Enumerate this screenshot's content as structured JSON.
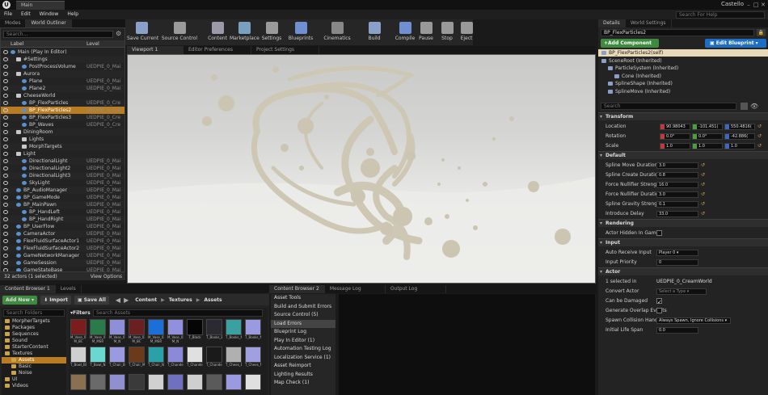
{
  "window": {
    "tab": "Main",
    "project": "Castello",
    "help_placeholder": "Search For Help"
  },
  "menu": [
    "File",
    "Edit",
    "Window",
    "Help"
  ],
  "left_tabs": [
    "Modes",
    "World Outliner"
  ],
  "outliner": {
    "search_placeholder": "Search...",
    "col_label": "Label",
    "col_type": "Level",
    "rows": [
      {
        "label": "Main (Play In Editor)",
        "type": "",
        "indent": 0,
        "icon": "actor"
      },
      {
        "label": "#Settings",
        "type": "",
        "indent": 1,
        "icon": "folder"
      },
      {
        "label": "PostProcessVolume",
        "type": "UEDPIE_0_Mai",
        "indent": 2,
        "icon": "actor"
      },
      {
        "label": "Aurora",
        "type": "",
        "indent": 1,
        "icon": "folder"
      },
      {
        "label": "Plane",
        "type": "UEDPIE_0_Mai",
        "indent": 2,
        "icon": "actor"
      },
      {
        "label": "Plane2",
        "type": "UEDPIE_0_Mai",
        "indent": 2,
        "icon": "actor"
      },
      {
        "label": "CheeseWorld",
        "type": "",
        "indent": 1,
        "icon": "folder"
      },
      {
        "label": "BP_FlexParticles",
        "type": "UEDPIE_0_Cre",
        "indent": 2,
        "icon": "actor"
      },
      {
        "label": "BP_FlexParticles2",
        "type": "UEDPIE_0_Cre",
        "indent": 2,
        "icon": "actor",
        "sel": true
      },
      {
        "label": "BP_FlexParticles3",
        "type": "UEDPIE_0_Cre",
        "indent": 2,
        "icon": "actor"
      },
      {
        "label": "BP_Waves",
        "type": "UEDPIE_0_Cre",
        "indent": 2,
        "icon": "actor"
      },
      {
        "label": "DiningRoom",
        "type": "",
        "indent": 1,
        "icon": "folder"
      },
      {
        "label": "Lights",
        "type": "",
        "indent": 2,
        "icon": "folder"
      },
      {
        "label": "MorphTargets",
        "type": "",
        "indent": 2,
        "icon": "folder"
      },
      {
        "label": "Light",
        "type": "",
        "indent": 1,
        "icon": "folder"
      },
      {
        "label": "DirectionalLight",
        "type": "UEDPIE_0_Mai",
        "indent": 2,
        "icon": "actor"
      },
      {
        "label": "DirectionalLight2",
        "type": "UEDPIE_0_Mai",
        "indent": 2,
        "icon": "actor"
      },
      {
        "label": "DirectionalLight3",
        "type": "UEDPIE_0_Mai",
        "indent": 2,
        "icon": "actor"
      },
      {
        "label": "SkyLight",
        "type": "UEDPIE_0_Mai",
        "indent": 2,
        "icon": "actor"
      },
      {
        "label": "BP_AudioManager",
        "type": "UEDPIE_0_Mai",
        "indent": 1,
        "icon": "actor"
      },
      {
        "label": "BP_GameMode",
        "type": "UEDPIE_0_Mai",
        "indent": 1,
        "icon": "actor"
      },
      {
        "label": "BP_MainPawn",
        "type": "UEDPIE_0_Mai",
        "indent": 1,
        "icon": "actor"
      },
      {
        "label": "BP_HandLeft",
        "type": "UEDPIE_0_Mai",
        "indent": 2,
        "icon": "actor"
      },
      {
        "label": "BP_HandRight",
        "type": "UEDPIE_0_Mai",
        "indent": 2,
        "icon": "actor"
      },
      {
        "label": "BP_UserFlow",
        "type": "UEDPIE_0_Mai",
        "indent": 1,
        "icon": "actor"
      },
      {
        "label": "CameraActor",
        "type": "UEDPIE_0_Mai",
        "indent": 1,
        "icon": "actor"
      },
      {
        "label": "FlexFluidSurfaceActor1",
        "type": "UEDPIE_0_Mai",
        "indent": 1,
        "icon": "actor"
      },
      {
        "label": "FlexFluidSurfaceActor2",
        "type": "UEDPIE_0_Mai",
        "indent": 1,
        "icon": "actor"
      },
      {
        "label": "GameNetworkManager",
        "type": "UEDPIE_0_Mai",
        "indent": 1,
        "icon": "actor"
      },
      {
        "label": "GameSession",
        "type": "UEDPIE_0_Mai",
        "indent": 1,
        "icon": "actor"
      },
      {
        "label": "GameStateBase",
        "type": "UEDPIE_0_Mai",
        "indent": 1,
        "icon": "actor"
      }
    ],
    "footer": "32 actors (1 selected)",
    "view_options": "View Options"
  },
  "toolbar": [
    {
      "label": "Save Current"
    },
    {
      "label": "Source Control"
    },
    {
      "label": "Content"
    },
    {
      "label": "Marketplace"
    },
    {
      "label": "Settings"
    },
    {
      "label": "Blueprints"
    },
    {
      "label": "Cinematics"
    },
    {
      "label": "Build"
    },
    {
      "label": "Compile"
    },
    {
      "label": "Pause"
    },
    {
      "label": "Stop"
    },
    {
      "label": "Eject"
    }
  ],
  "viewport_tabs": [
    "Viewport 1",
    "Editor Preferences",
    "Project Settings"
  ],
  "content_browser": {
    "tabs": [
      "Content Browser 1",
      "Levels",
      "Content Browser 2"
    ],
    "add_new": "Add New",
    "import": "Import",
    "save_all": "Save All",
    "path": [
      "Content",
      "Textures",
      "Assets"
    ],
    "folder_search": "Search Folders",
    "filters": "Filters",
    "asset_search": "Search Assets",
    "tree": [
      {
        "label": "MorpherTargets",
        "indent": 0
      },
      {
        "label": "Packages",
        "indent": 0
      },
      {
        "label": "Sequences",
        "indent": 0
      },
      {
        "label": "Sound",
        "indent": 0
      },
      {
        "label": "StarterContent",
        "indent": 0
      },
      {
        "label": "Textures",
        "indent": 0
      },
      {
        "label": "Assets",
        "indent": 1,
        "sel": true
      },
      {
        "label": "Basic",
        "indent": 1
      },
      {
        "label": "Noise",
        "indent": 1
      },
      {
        "label": "UI",
        "indent": 0
      },
      {
        "label": "Videos",
        "indent": 0
      }
    ],
    "tiles": [
      {
        "label": "M_Vase_01 M_BC",
        "color": "#7a1d1d"
      },
      {
        "label": "M_Vase_01 M_MSR",
        "color": "#2a7a4a"
      },
      {
        "label": "M_Vase_01 M_N",
        "color": "#8f8fd8"
      },
      {
        "label": "M_Vase_02 M_BC",
        "color": "#6a2020"
      },
      {
        "label": "M_Vase_02 M_MSR",
        "color": "#1e6ed8"
      },
      {
        "label": "M_Vase_02 M_N",
        "color": "#9090dc"
      },
      {
        "label": "T_Black",
        "color": "#050505"
      },
      {
        "label": "T_Books_BC",
        "color": "#2a2a30"
      },
      {
        "label": "T_Books_MSR",
        "color": "#3aa0a0"
      },
      {
        "label": "T_Books_N",
        "color": "#9a9ae0"
      },
      {
        "label": "T_Bowl_BC",
        "color": "#cfcfcf"
      },
      {
        "label": "T_Bowl_N",
        "color": "#6ad8d0"
      },
      {
        "label": "T_Chair_BC",
        "color": "#9a9ae0"
      },
      {
        "label": "T_Chair_MSR",
        "color": "#6a3a1a"
      },
      {
        "label": "T_Chair_N",
        "color": "#2aa0a8"
      },
      {
        "label": "T_Chandelier_BC",
        "color": "#8a8ad8"
      },
      {
        "label": "T_Chandelier_MSR",
        "color": "#e0e0e0"
      },
      {
        "label": "T_Chandelier_N",
        "color": "#1a1a1a"
      },
      {
        "label": "T_Chees_BC",
        "color": "#b0b0b0"
      },
      {
        "label": "T_Chees_N",
        "color": "#a0a0e0"
      },
      {
        "label": "",
        "color": "#8a7050"
      },
      {
        "label": "",
        "color": "#6a6a6a"
      },
      {
        "label": "",
        "color": "#9090d0"
      },
      {
        "label": "",
        "color": "#3a3a3a"
      },
      {
        "label": "",
        "color": "#d0d0d0"
      },
      {
        "label": "",
        "color": "#7070c0"
      },
      {
        "label": "",
        "color": "#cfcfcf"
      },
      {
        "label": "",
        "color": "#5a5a5a"
      },
      {
        "label": "",
        "color": "#9a9ae0"
      },
      {
        "label": "",
        "color": "#e0e0e0"
      }
    ]
  },
  "log": {
    "tabs": [
      "Message Log",
      "Output Log"
    ],
    "items": [
      "Asset Tools",
      "Build and Submit Errors",
      "Source Control (5)",
      "Load Errors",
      "Blueprint Log",
      "Play In Editor (1)",
      "Automation Testing Log",
      "Localization Service (1)",
      "Asset Reimport",
      "Lighting Results",
      "Map Check (1)"
    ],
    "selected": 3
  },
  "details": {
    "tabs": [
      "Details",
      "World Settings"
    ],
    "actor": "BP_FlexParticles2",
    "add_component": "+Add Component",
    "edit_blueprint": "Edit Blueprint",
    "components": [
      {
        "label": "BP_FlexParticles2(self)",
        "indent": 0,
        "sel": true
      },
      {
        "label": "SceneRoot (Inherited)",
        "indent": 0
      },
      {
        "label": "ParticleSystem (Inherited)",
        "indent": 1
      },
      {
        "label": "Cone (Inherited)",
        "indent": 2
      },
      {
        "label": "SplineShape (Inherited)",
        "indent": 1
      },
      {
        "label": "SplineMove (Inherited)",
        "indent": 1
      }
    ],
    "search_placeholder": "Search",
    "transform": {
      "title": "Transform",
      "location": {
        "label": "Location",
        "x": "90.98043",
        "y": "-101.451(",
        "z": "550.4816("
      },
      "rotation": {
        "label": "Rotation",
        "x": "0.0°",
        "y": "0.0°",
        "z": "-42.886("
      },
      "scale": {
        "label": "Scale",
        "x": "1.0",
        "y": "1.0",
        "z": "1.0"
      }
    },
    "default": {
      "title": "Default",
      "props": [
        {
          "label": "Spline Move Duration",
          "value": "3.0"
        },
        {
          "label": "Spline Create Duration",
          "value": "0.8"
        },
        {
          "label": "Force Nullifier Strength",
          "value": "16.0"
        },
        {
          "label": "Force Nullifier Duration",
          "value": "3.0"
        },
        {
          "label": "Spline Gravity Strength",
          "value": "0.1"
        },
        {
          "label": "Introduce Delay",
          "value": "33.0"
        }
      ]
    },
    "rendering": {
      "title": "Rendering",
      "label": "Actor Hidden In Game"
    },
    "input": {
      "title": "Input",
      "receive_label": "Auto Receive Input",
      "receive_value": "Player 0",
      "priority_label": "Input Priority",
      "priority_value": "0"
    },
    "actor_sect": {
      "title": "Actor",
      "selected_label": "1 selected in",
      "selected_value": "UEDPIE_0_CreamWorld",
      "convert_label": "Convert Actor",
      "convert_value": "Select a Type",
      "damaged_label": "Can be Damaged",
      "overlap_label": "Generate Overlap Events",
      "collision_label": "Spawn Collision Handling",
      "collision_value": "Always Spawn, Ignore Collisions",
      "lifespan_label": "Initial Life Span",
      "lifespan_value": "0.0"
    }
  }
}
